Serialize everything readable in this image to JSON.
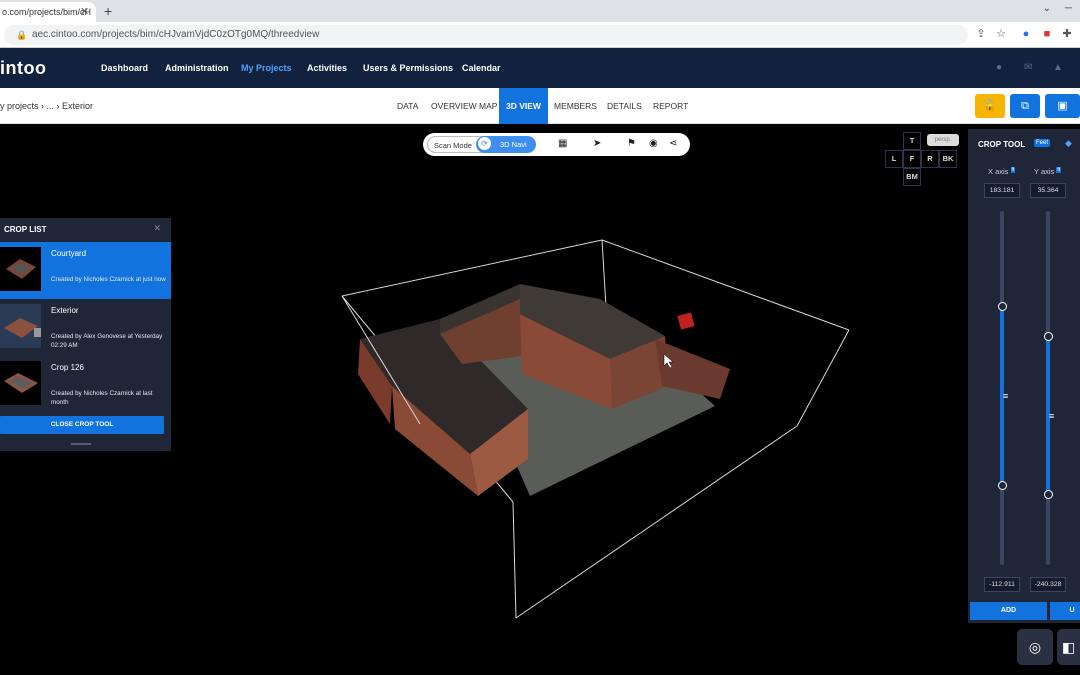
{
  "browser": {
    "tab_title": "o.com/projects/bim/cH",
    "url": "aec.cintoo.com/projects/bim/cHJvamVjdC0zOTg0MQ/threedview"
  },
  "app": {
    "logo": "intoo",
    "nav": [
      "Dashboard",
      "Administration",
      "My Projects",
      "Activities",
      "Users & Permissions",
      "Calendar"
    ],
    "active_nav": "My Projects"
  },
  "subheader": {
    "breadcrumb": "y projects  ›    ...   › Exterior",
    "tabs": [
      "DATA",
      "OVERVIEW MAP",
      "3D VIEW",
      "MEMBERS",
      "DETAILS",
      "REPORT"
    ],
    "active_tab": "3D VIEW"
  },
  "toolbar": {
    "scan_mode_label": "Scan Mode",
    "navi_label": "3D Navi"
  },
  "view_cube": {
    "top": "T",
    "left": "L",
    "front": "F",
    "right": "R",
    "back": "BK",
    "bottom": "BM",
    "projection": "persp."
  },
  "crop_list": {
    "title": "CROP LIST",
    "items": [
      {
        "name": "Courtyard",
        "created": "Created by Nicholes Czarnick at just now"
      },
      {
        "name": "Exterior",
        "created": "Created by Alex Genovese at Yesterday 02:29 AM"
      },
      {
        "name": "Crop 126",
        "created": "Created by Nicholes Czarnick at last month"
      }
    ],
    "close_button": "CLOSE CROP TOOL"
  },
  "crop_tool": {
    "title": "CROP TOOL",
    "unit": "Feet",
    "unit_badge": "ft",
    "x_axis": {
      "label": "X axis",
      "max": "183.181",
      "min": "-112.911"
    },
    "y_axis": {
      "label": "Y axis",
      "max": "35.364",
      "min": "-240.328"
    },
    "add_button": "ADD",
    "second_button": "U"
  },
  "colors": {
    "header_bg": "#12213d",
    "accent": "#1273de",
    "panel_bg": "#1e2638",
    "yellow_button": "#f7b500"
  }
}
